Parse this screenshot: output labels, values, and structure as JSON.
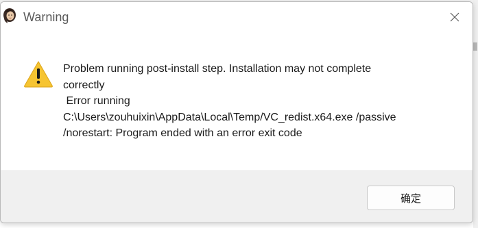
{
  "window": {
    "title": "Warning",
    "close_icon": "close-icon",
    "app_icon": "app-avatar-icon"
  },
  "message": {
    "icon": "warning-triangle-icon",
    "lines": [
      "Problem running post-install step. Installation may not complete",
      "correctly",
      " Error running",
      "C:\\Users\\zouhuixin\\AppData\\Local\\Temp/VC_redist.x64.exe /passive",
      "/norestart: Program ended with an error exit code"
    ]
  },
  "footer": {
    "ok_label": "确定"
  },
  "colors": {
    "warning_fill": "#f6c431",
    "footer_bg": "#f0f0f0",
    "title_text": "#5a5a5a"
  }
}
